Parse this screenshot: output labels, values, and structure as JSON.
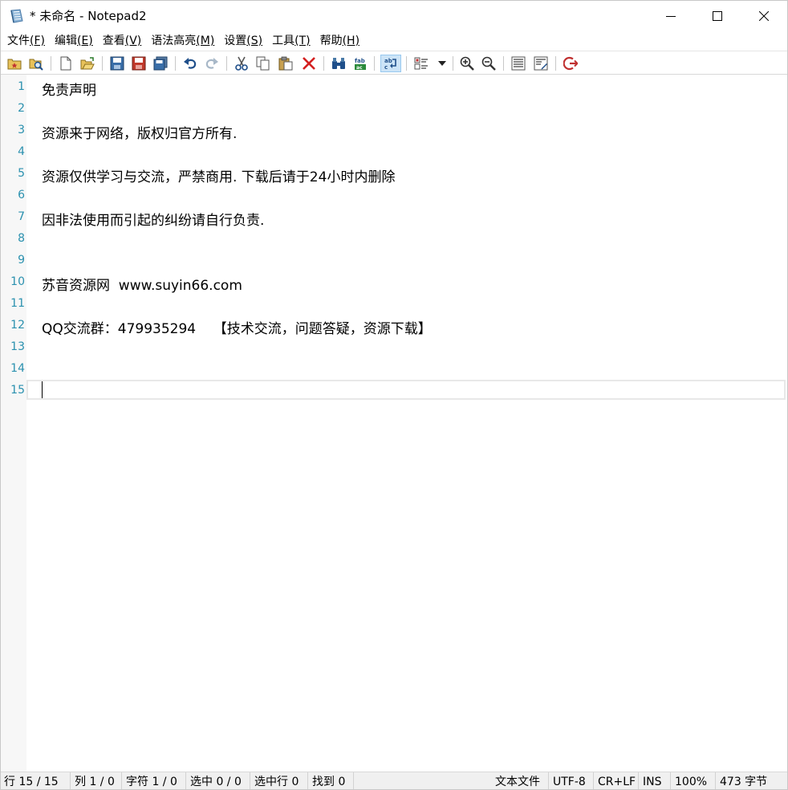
{
  "window": {
    "title": "* 未命名 - Notepad2"
  },
  "menu": {
    "items": [
      {
        "label": "文件",
        "accel": "(F)"
      },
      {
        "label": "编辑",
        "accel": "(E)"
      },
      {
        "label": "查看",
        "accel": "(V)"
      },
      {
        "label": "语法高亮",
        "accel": "(M)"
      },
      {
        "label": "设置",
        "accel": "(S)"
      },
      {
        "label": "工具",
        "accel": "(T)"
      },
      {
        "label": "帮助",
        "accel": "(H)"
      }
    ]
  },
  "toolbar": {
    "icons": [
      "favorites-icon",
      "browse-icon",
      "new-file-icon",
      "open-file-icon",
      "save-icon",
      "save-as-icon",
      "save-copy-icon",
      "undo-icon",
      "redo-icon",
      "cut-icon",
      "copy-icon",
      "paste-icon",
      "delete-icon",
      "find-icon",
      "replace-icon",
      "word-wrap-icon",
      "scheme-icon",
      "zoom-in-icon",
      "zoom-out-icon",
      "page-setup-icon",
      "print-icon",
      "exit-icon"
    ]
  },
  "editor": {
    "lines": [
      "免责声明",
      "",
      "资源来于网络，版权归官方所有.",
      "",
      "资源仅供学习与交流，严禁商用. 下载后请于24小时内删除",
      "",
      "因非法使用而引起的纠纷请自行负责.",
      "",
      "",
      "苏音资源网  www.suyin66.com",
      "",
      "QQ交流群：479935294    【技术交流，问题答疑，资源下载】",
      "",
      "",
      ""
    ],
    "line_numbers": [
      "1",
      "2",
      "3",
      "4",
      "5",
      "6",
      "7",
      "8",
      "9",
      "10",
      "11",
      "12",
      "13",
      "14",
      "15"
    ]
  },
  "status": {
    "line": "行 15 / 15",
    "col": "列 1 / 0",
    "char": "字符 1 / 0",
    "sel": "选中 0 / 0",
    "sel_lines": "选中行 0",
    "found": "找到 0",
    "file_type": "文本文件",
    "encoding": "UTF-8",
    "eol": "CR+LF",
    "ins": "INS",
    "zoom": "100%",
    "size": "473 字节"
  },
  "colors": {
    "line_number": "#2b91af",
    "active_button_bg": "#cce4f7",
    "statusbar_bg": "#f0f0f0"
  }
}
